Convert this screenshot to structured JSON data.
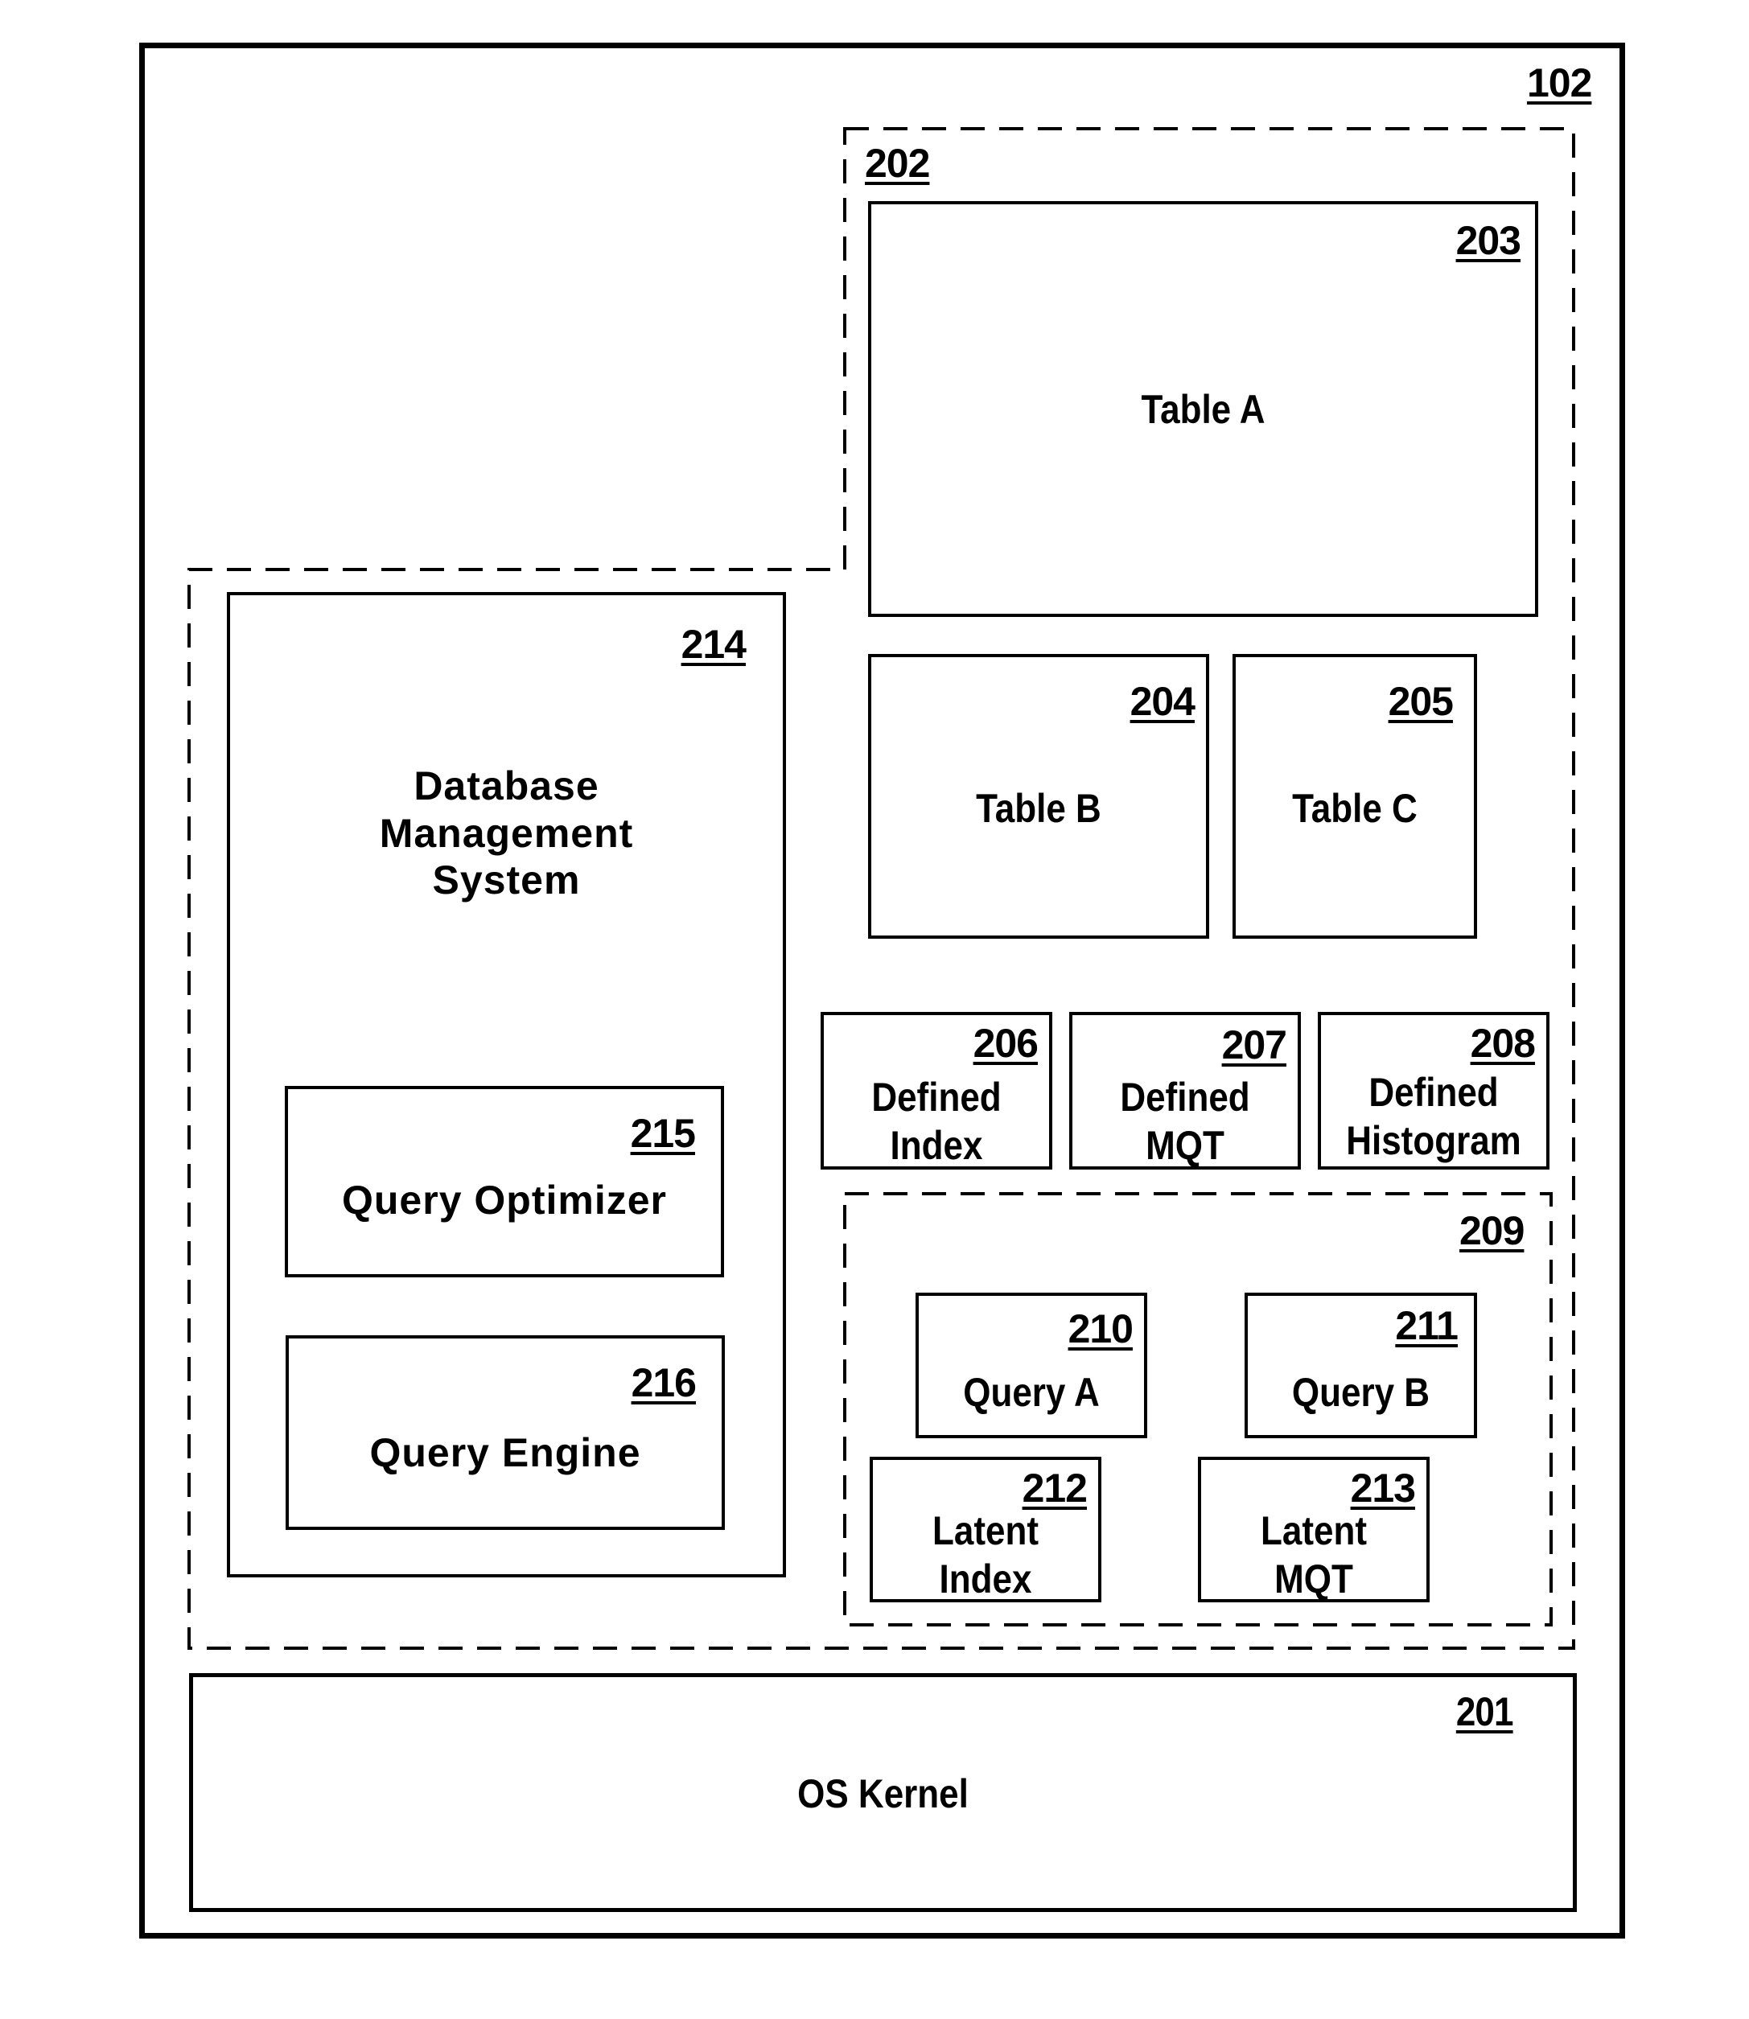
{
  "figure": {
    "system": {
      "ref": "102"
    },
    "memory_region": {
      "ref": "202"
    },
    "table_a": {
      "ref": "203",
      "label": "Table A"
    },
    "table_b": {
      "ref": "204",
      "label": "Table B"
    },
    "table_c": {
      "ref": "205",
      "label": "Table C"
    },
    "defined_index": {
      "ref": "206",
      "label_line1": "Defined",
      "label_line2": "Index"
    },
    "defined_mqt": {
      "ref": "207",
      "label_line1": "Defined",
      "label_line2": "MQT"
    },
    "defined_histogram": {
      "ref": "208",
      "label_line1": "Defined",
      "label_line2": "Histogram"
    },
    "query_group": {
      "ref": "209"
    },
    "query_a": {
      "ref": "210",
      "label": "Query A"
    },
    "query_b": {
      "ref": "211",
      "label": "Query B"
    },
    "latent_index": {
      "ref": "212",
      "label_line1": "Latent",
      "label_line2": "Index"
    },
    "latent_mqt": {
      "ref": "213",
      "label_line1": "Latent",
      "label_line2": "MQT"
    },
    "dbms": {
      "ref": "214",
      "label_line1": "Database",
      "label_line2": "Management",
      "label_line3": "System"
    },
    "query_optimizer": {
      "ref": "215",
      "label": "Query Optimizer"
    },
    "query_engine": {
      "ref": "216",
      "label": "Query Engine"
    },
    "os_kernel": {
      "ref": "201",
      "label": "OS Kernel"
    }
  }
}
